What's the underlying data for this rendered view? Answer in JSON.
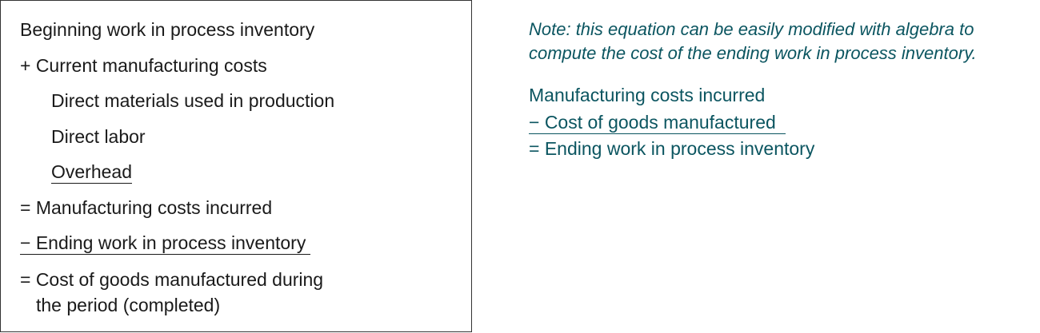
{
  "left_panel": {
    "lines": [
      "Beginning work in process inventory",
      "+ Current manufacturing costs",
      "Direct materials used in production",
      "Direct labor",
      "Overhead",
      "= Manufacturing costs incurred",
      "− Ending work in process inventory",
      "= Cost of goods manufactured during",
      "the period (completed)"
    ]
  },
  "right_panel": {
    "note_line1": "Note: this equation can be easily modified with algebra to",
    "note_line2": "compute the cost of the ending work in process inventory.",
    "equation": [
      "Manufacturing costs incurred",
      "− Cost of goods manufactured",
      "= Ending work in process inventory"
    ]
  },
  "colors": {
    "text": "#1a1a1a",
    "teal": "#0b5560",
    "border": "#333333"
  }
}
